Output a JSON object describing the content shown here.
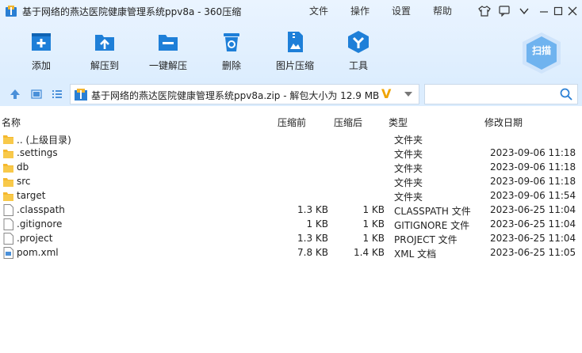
{
  "window": {
    "title": "基于网络的燕达医院健康管理系统ppv8a - 360压缩",
    "menu": [
      "文件",
      "操作",
      "设置",
      "帮助"
    ]
  },
  "toolbar": {
    "items": [
      {
        "label": "添加",
        "icon": "add-icon"
      },
      {
        "label": "解压到",
        "icon": "extract-to-icon"
      },
      {
        "label": "一键解压",
        "icon": "one-click-extract-icon"
      },
      {
        "label": "删除",
        "icon": "delete-icon"
      },
      {
        "label": "图片压缩",
        "icon": "image-compress-icon"
      },
      {
        "label": "工具",
        "icon": "tools-icon"
      }
    ],
    "scan_label": "扫描"
  },
  "address": {
    "path": "基于网络的燕达医院健康管理系统ppv8a.zip - 解包大小为 12.9 MB",
    "v_badge": "V",
    "search_placeholder": ""
  },
  "columns": {
    "name": "名称",
    "compressed": "压缩前",
    "after": "压缩后",
    "type": "类型",
    "modified": "修改日期"
  },
  "files": [
    {
      "name": ".. (上级目录)",
      "before": "",
      "after": "",
      "type": "文件夹",
      "date": "",
      "kind": "folder"
    },
    {
      "name": ".settings",
      "before": "",
      "after": "",
      "type": "文件夹",
      "date": "2023-09-06 11:18",
      "kind": "folder"
    },
    {
      "name": "db",
      "before": "",
      "after": "",
      "type": "文件夹",
      "date": "2023-09-06 11:18",
      "kind": "folder"
    },
    {
      "name": "src",
      "before": "",
      "after": "",
      "type": "文件夹",
      "date": "2023-09-06 11:18",
      "kind": "folder"
    },
    {
      "name": "target",
      "before": "",
      "after": "",
      "type": "文件夹",
      "date": "2023-09-06 11:54",
      "kind": "folder"
    },
    {
      "name": ".classpath",
      "before": "1.3 KB",
      "after": "1 KB",
      "type": "CLASSPATH 文件",
      "date": "2023-06-25 11:04",
      "kind": "file"
    },
    {
      "name": ".gitignore",
      "before": "1 KB",
      "after": "1 KB",
      "type": "GITIGNORE 文件",
      "date": "2023-06-25 11:04",
      "kind": "file"
    },
    {
      "name": ".project",
      "before": "1.3 KB",
      "after": "1 KB",
      "type": "PROJECT 文件",
      "date": "2023-06-25 11:04",
      "kind": "file"
    },
    {
      "name": "pom.xml",
      "before": "7.8 KB",
      "after": "1.4 KB",
      "type": "XML 文档",
      "date": "2023-06-25 11:05",
      "kind": "xml"
    }
  ],
  "colors": {
    "accent": "#1e88e5",
    "folder": "#f5b82e",
    "topbar": "#dcedfe"
  }
}
